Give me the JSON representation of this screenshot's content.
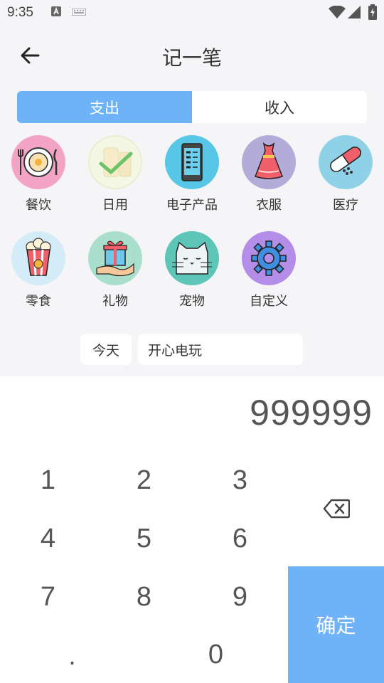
{
  "status_bar": {
    "time": "9:35"
  },
  "header": {
    "title": "记一笔"
  },
  "tabs": {
    "expense": "支出",
    "income": "收入"
  },
  "categories": [
    {
      "label": "餐饮",
      "color": "#f3a3c4"
    },
    {
      "label": "日用",
      "color": "#f4f7e3"
    },
    {
      "label": "电子产品",
      "color": "#58c6e6"
    },
    {
      "label": "衣服",
      "color": "#b4acd8"
    },
    {
      "label": "医疗",
      "color": "#8fd1e6"
    },
    {
      "label": "零食",
      "color": "#d3ecf7"
    },
    {
      "label": "礼物",
      "color": "#aadfcd"
    },
    {
      "label": "宠物",
      "color": "#5ec6b8"
    },
    {
      "label": "自定义",
      "color": "#b48de8"
    }
  ],
  "entry": {
    "date": "今天",
    "note": "开心电玩"
  },
  "keypad": {
    "amount": "999999",
    "keys": [
      "1",
      "2",
      "3",
      "4",
      "5",
      "6",
      "7",
      "8",
      "9",
      ".",
      "0"
    ],
    "confirm": "确定"
  },
  "colors": {
    "accent": "#6eb3f7",
    "background": "#f5f5f7"
  }
}
